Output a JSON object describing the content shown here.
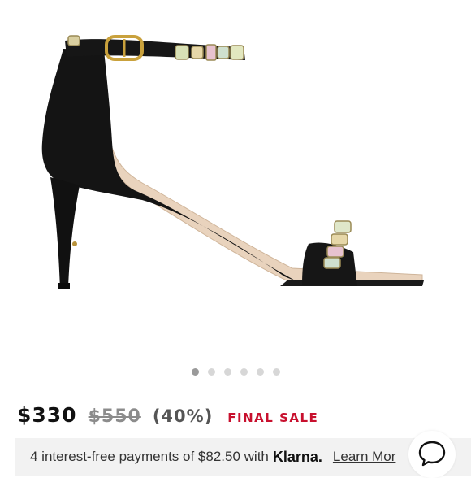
{
  "product": {
    "image_alt": "Black suede ankle-strap sandal with jeweled straps",
    "carousel": {
      "total": 6,
      "active_index": 0
    }
  },
  "pricing": {
    "current_price": "$330",
    "original_price": "$550",
    "discount": "(40%)",
    "sale_label": "FINAL SALE"
  },
  "klarna": {
    "message": "4 interest-free payments of $82.50 with",
    "brand": "Klarna.",
    "link": "Learn Mor"
  },
  "icons": {
    "chat": "chat-bubble-icon"
  },
  "colors": {
    "sale_red": "#c8102e",
    "strikethrough_gray": "#8c8c8c",
    "klarna_bg": "#f2f2f2"
  }
}
